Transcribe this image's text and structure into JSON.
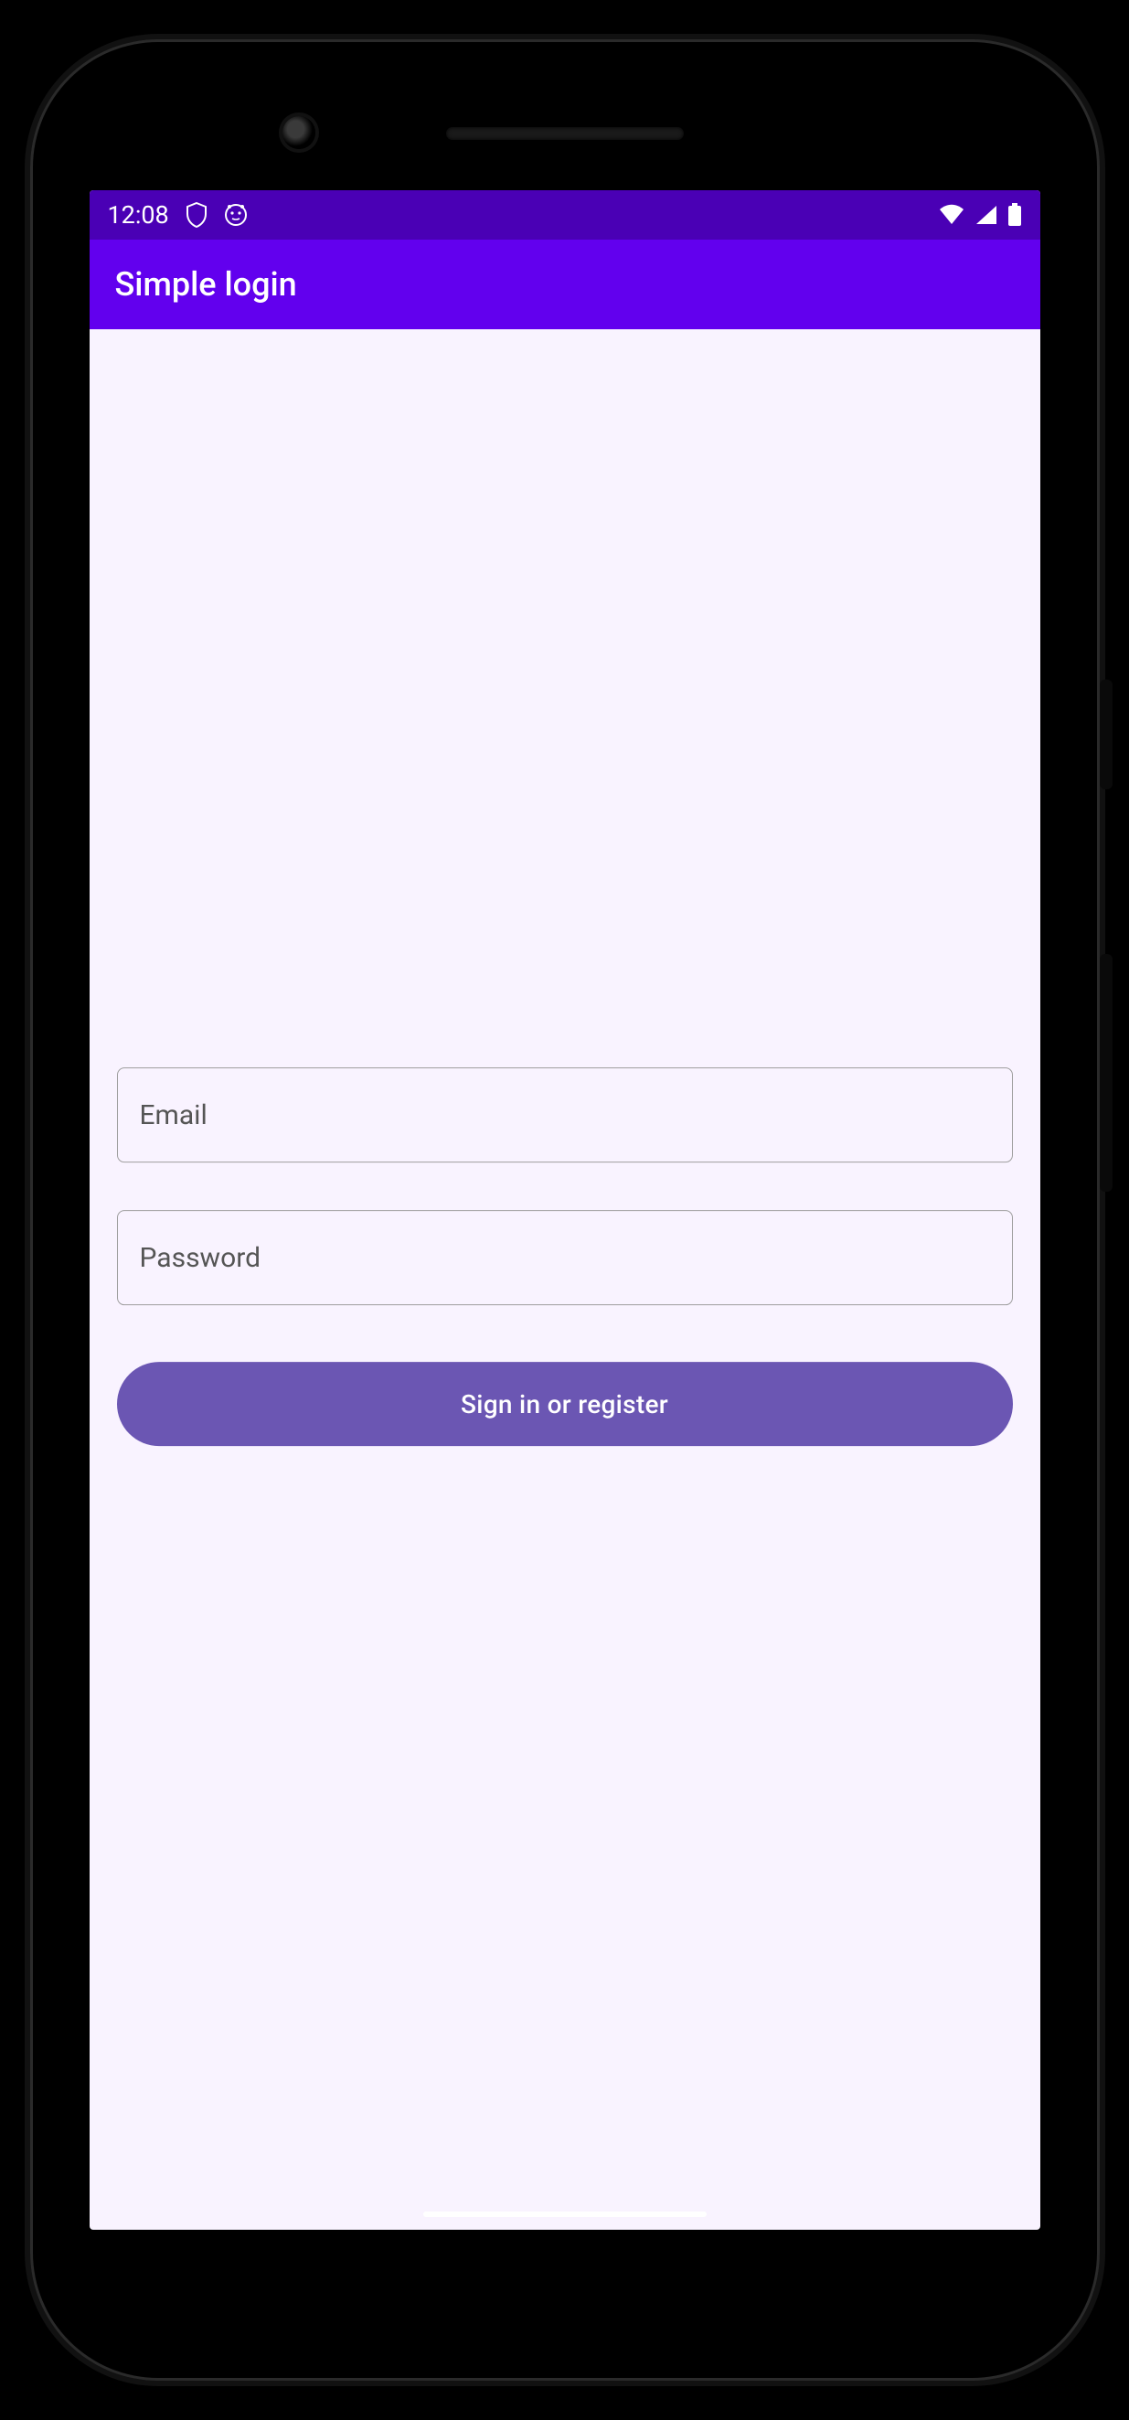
{
  "status": {
    "time": "12:08"
  },
  "appbar": {
    "title": "Simple login"
  },
  "form": {
    "email_placeholder": "Email",
    "email_value": "",
    "password_placeholder": "Password",
    "password_value": "",
    "submit_label": "Sign in or register"
  },
  "colors": {
    "status_bar": "#4a00b5",
    "app_bar": "#6200ee",
    "screen_bg": "#f9f3ff",
    "button": "#6b56b3"
  }
}
